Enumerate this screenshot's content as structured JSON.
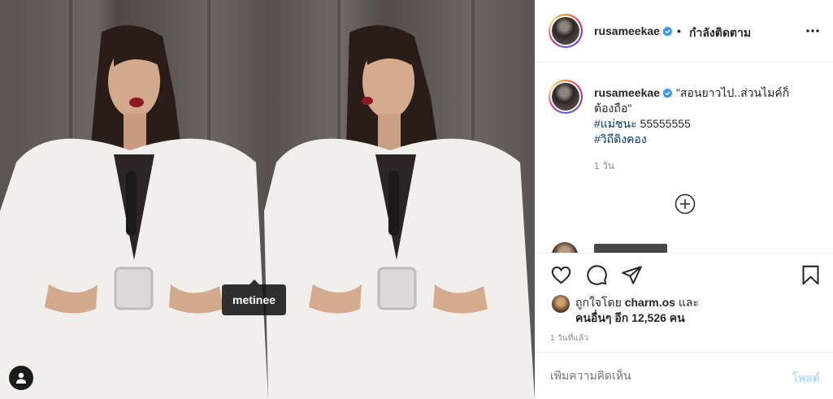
{
  "photo": {
    "tag_label": "metinee",
    "user_tag_icon": "person-icon"
  },
  "post_header": {
    "username": "rusameekae",
    "verified": true,
    "separator": "•",
    "follow_status": "กำลังติดตาม",
    "more_icon": "more-options-icon"
  },
  "caption": {
    "username": "rusameekae",
    "text_line1": "\"สอนยาวไป..ส่วนไมค์ก็",
    "text_line2": "ต้องถือ\"",
    "hashtag1": "#แม่ชนะ",
    "hashtag1_suffix": " 55555555",
    "hashtag2": "#วิถีติงคอง",
    "age": "1 วัน"
  },
  "actions": {
    "like_icon": "heart-icon",
    "comment_icon": "comment-icon",
    "share_icon": "paper-plane-icon",
    "save_icon": "bookmark-icon"
  },
  "likes": {
    "prefix": "ถูกใจโดย ",
    "first_liker": "charm.os",
    "and": " และ",
    "others": "คนอื่นๆ อีก 12,526 คน"
  },
  "timestamp": "1 วันที่แล้ว",
  "comment": {
    "placeholder": "เพิ่มความคิดเห็น",
    "post_label": "โพสต์"
  },
  "colors": {
    "verified_blue": "#3897f0",
    "link_blue": "#00376b",
    "post_button_disabled": "#b2dffc"
  }
}
